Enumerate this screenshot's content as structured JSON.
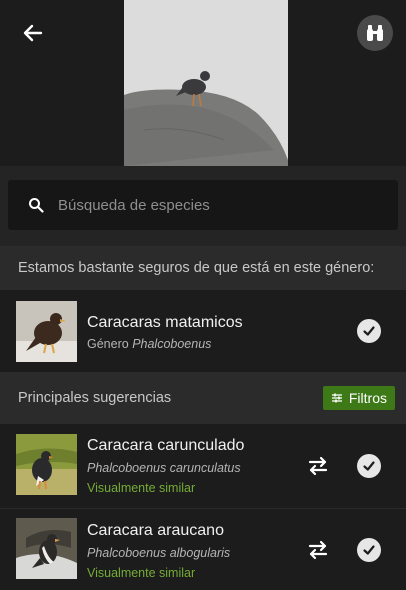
{
  "header": {
    "back_icon": "arrow-left-icon",
    "compare_icon": "binoculars-icon"
  },
  "search": {
    "placeholder": "Búsqueda de especies",
    "icon": "search-icon"
  },
  "genus_section": {
    "heading": "Estamos bastante seguros de que está en este género:",
    "item": {
      "name": "Caracaras matamicos",
      "rank_label": "Género",
      "scientific": "Phalcoboenus"
    }
  },
  "suggestions_section": {
    "heading": "Principales sugerencias",
    "filter_label": "Filtros",
    "items": [
      {
        "name": "Caracara carunculado",
        "scientific": "Phalcoboenus carunculatus",
        "tag": "Visualmente similar"
      },
      {
        "name": "Caracara araucano",
        "scientific": "Phalcoboenus albogularis",
        "tag": "Visualmente similar"
      }
    ]
  },
  "colors": {
    "accent_green": "#3d7a17",
    "tag_green": "#74ac35",
    "background": "#2b2b2b",
    "row_background": "#1c1c1c"
  }
}
